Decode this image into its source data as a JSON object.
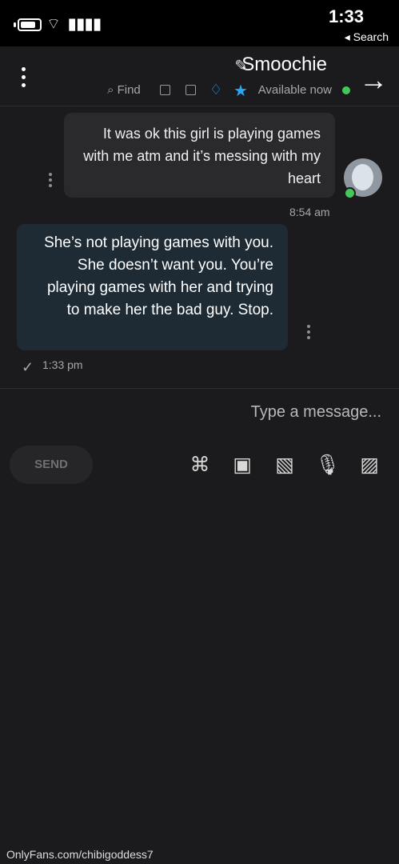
{
  "status": {
    "time": "1:33",
    "back_label": "◂ Search"
  },
  "chat": {
    "name": "Smoochie",
    "presence": "Available now",
    "find_label": "Find",
    "messages": [
      {
        "text": "It was ok this girl is playing games with me atm and it’s messing with my heart",
        "time": "8:54 am"
      },
      {
        "text": "She’s not playing games with you. She doesn’t want you. You’re playing games with her and trying to make her the bad guy. Stop.",
        "time": "1:33 pm"
      }
    ]
  },
  "composer": {
    "placeholder": "Type a message...",
    "send_label": "SEND"
  },
  "footer": {
    "link": "OnlyFans.com/chibigoddess7"
  },
  "colors": {
    "background": "#1b1b1d",
    "accent": "#26a8f5",
    "online": "#43c75a"
  },
  "icons": [
    "battery-icon",
    "wifi-icon",
    "signal-icon",
    "pencil-icon",
    "star-icon",
    "bell-icon",
    "arrow-right-icon",
    "more-vert-icon",
    "image-icon",
    "microphone-icon",
    "calendar-icon",
    "tag-icon"
  ]
}
